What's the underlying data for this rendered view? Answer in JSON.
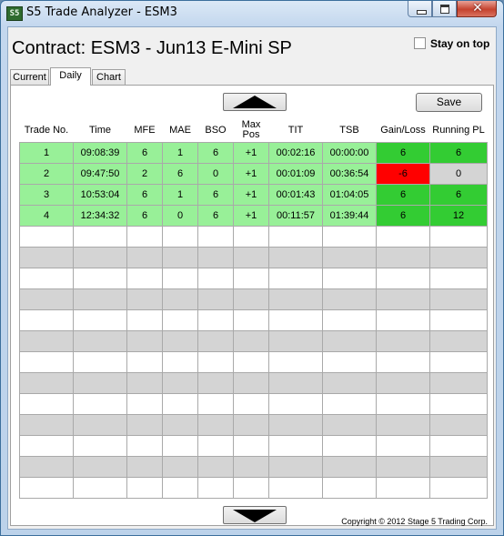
{
  "window": {
    "title": "S5 Trade Analyzer - ESM3",
    "app_icon_text": "S5"
  },
  "header": {
    "contract_label": "Contract: ESM3 - Jun13 E-Mini SP",
    "stay_on_top_label": "Stay on top",
    "stay_on_top_checked": false
  },
  "tabs": [
    {
      "label": "Current",
      "active": false
    },
    {
      "label": "Daily",
      "active": true
    },
    {
      "label": "Chart",
      "active": false
    }
  ],
  "toolbar": {
    "save_label": "Save",
    "scroll_up_icon": "triangle-up-icon",
    "scroll_down_icon": "triangle-down-icon"
  },
  "table": {
    "columns": [
      "Trade No.",
      "Time",
      "MFE",
      "MAE",
      "BSO",
      "Max Pos",
      "TIT",
      "TSB",
      "Gain/Loss",
      "Running PL"
    ],
    "rows": [
      [
        "1",
        "09:08:39",
        "6",
        "1",
        "6",
        "+1",
        "00:02:16",
        "00:00:00",
        "6",
        "6"
      ],
      [
        "2",
        "09:47:50",
        "2",
        "6",
        "0",
        "+1",
        "00:01:09",
        "00:36:54",
        "-6",
        "0"
      ],
      [
        "3",
        "10:53:04",
        "6",
        "1",
        "6",
        "+1",
        "00:01:43",
        "01:04:05",
        "6",
        "6"
      ],
      [
        "4",
        "12:34:32",
        "6",
        "0",
        "6",
        "+1",
        "00:11:57",
        "01:39:44",
        "6",
        "12"
      ]
    ],
    "empty_rows": 13,
    "colors": {
      "row_bg": "#98f098",
      "gain": "#33cc33",
      "loss": "#ff0000",
      "flat": "#d4d4d4",
      "stripe": "#d4d4d4"
    }
  },
  "footer": {
    "copyright": "Copyright © 2012 Stage 5 Trading Corp."
  }
}
